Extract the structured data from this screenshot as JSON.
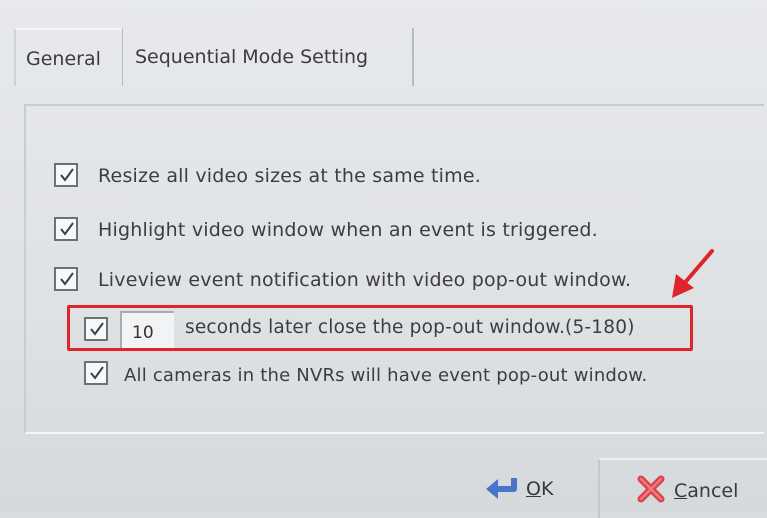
{
  "tabs": [
    {
      "label": "General"
    },
    {
      "label": "Sequential Mode Setting"
    }
  ],
  "options": [
    {
      "label": "Resize all video sizes at the same time.",
      "checked": true
    },
    {
      "label": "Highlight video window when an event is triggered.",
      "checked": true
    },
    {
      "label": "Liveview event notification with video pop-out window.",
      "checked": true
    }
  ],
  "popout": {
    "checked": true,
    "seconds_value": "10",
    "label": "seconds later close the pop-out window.(5-180)"
  },
  "all_cameras": {
    "checked": true,
    "label": "All cameras in the NVRs will have event pop-out window."
  },
  "buttons": {
    "ok_underlined": "O",
    "ok_rest": "K",
    "cancel_underlined": "C",
    "cancel_rest": "ancel"
  },
  "colors": {
    "highlight_box": "#e0252a",
    "annotation_arrow": "#e0252a"
  }
}
